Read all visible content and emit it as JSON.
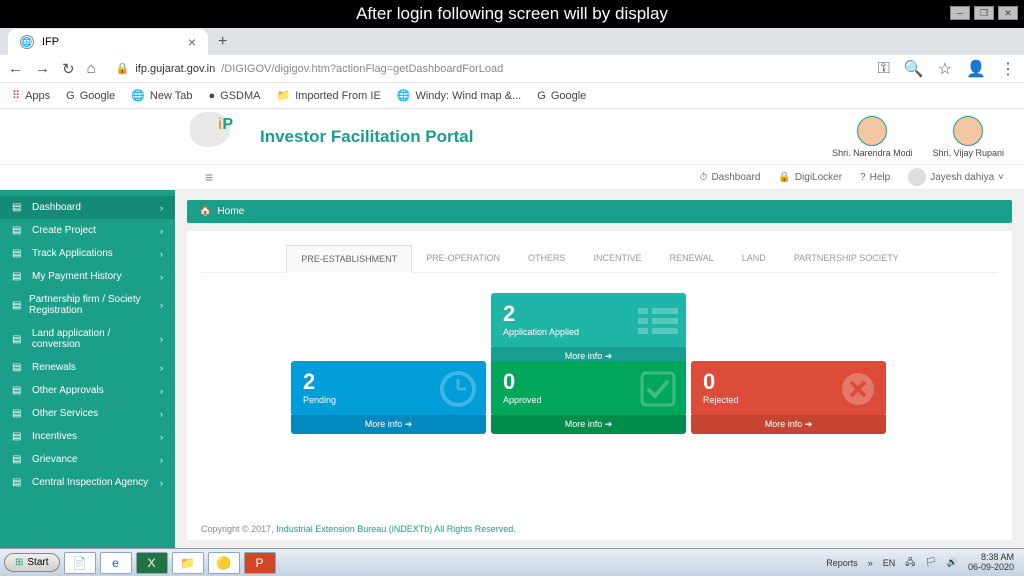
{
  "title_bar": "After  login following screen will by display",
  "browser": {
    "tab_title": "IFP",
    "url_domain": "ifp.gujarat.gov.in",
    "url_path": "/DIGIGOV/digigov.htm?actionFlag=getDashboardForLoad",
    "bookmarks_label": "Apps",
    "bookmarks": [
      "Google",
      "New Tab",
      "GSDMA",
      "Imported From IE",
      "Windy: Wind map &...",
      "Google"
    ]
  },
  "header": {
    "portal_title": "Investor Facilitation Portal",
    "leader1": "Shri. Narendra Modi",
    "leader2": "Shri. Vijay Rupani"
  },
  "toolbar": {
    "dashboard": "Dashboard",
    "digilocker": "DigiLocker",
    "help": "Help",
    "user": "Jayesh dahiya"
  },
  "sidebar": {
    "items": [
      "Dashboard",
      "Create Project",
      "Track Applications",
      "My Payment History",
      "Partnership firm / Society Registration",
      "Land application / conversion",
      "Renewals",
      "Other Approvals",
      "Other Services",
      "Incentives",
      "Grievance",
      "Central Inspection Agency"
    ]
  },
  "breadcrumb": {
    "home": "Home"
  },
  "tabs": [
    "PRE-ESTABLISHMENT",
    "PRE-OPERATION",
    "OTHERS",
    "INCENTIVE",
    "RENEWAL",
    "LAND",
    "PARTNERSHIP SOCIETY"
  ],
  "cards": {
    "applied": {
      "num": "2",
      "label": "Application Applied",
      "more": "More info ➔"
    },
    "pending": {
      "num": "2",
      "label": "Pending",
      "more": "More info ➔"
    },
    "approved": {
      "num": "0",
      "label": "Approved",
      "more": "More info ➔"
    },
    "rejected": {
      "num": "0",
      "label": "Rejected",
      "more": "More info ➔"
    }
  },
  "footer": {
    "copyright": "Copyright © 2017, ",
    "link": "Industrial Extension Bureau (iNDEXTb) All Rights Reserved."
  },
  "taskbar": {
    "start": "Start",
    "reports": "Reports",
    "lang": "EN",
    "time": "8:38 AM",
    "date": "06-09-2020"
  }
}
